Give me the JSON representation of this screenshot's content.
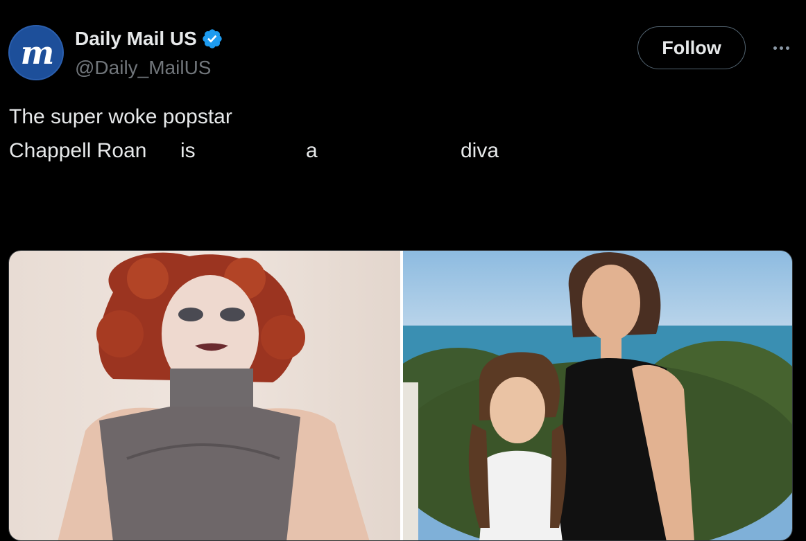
{
  "post": {
    "author": {
      "display_name": "Daily Mail US",
      "handle": "@Daily_MailUS",
      "verified": true,
      "avatar_icon": "daily-mail-logo-icon"
    },
    "follow_label": "Follow",
    "more_icon": "more-options-icon",
    "text": {
      "line1": "The super woke popstar",
      "line2_parts": [
        "Chappell Roan",
        "is",
        "a",
        "diva"
      ]
    },
    "media": {
      "count": 2,
      "items": [
        "photo-left",
        "photo-right"
      ]
    }
  },
  "colors": {
    "background": "#000000",
    "text_primary": "#e7e9ea",
    "text_secondary": "#71767b",
    "verified_blue": "#1d9bf0",
    "avatar_blue": "#1d4f9a",
    "border": "#536471"
  }
}
